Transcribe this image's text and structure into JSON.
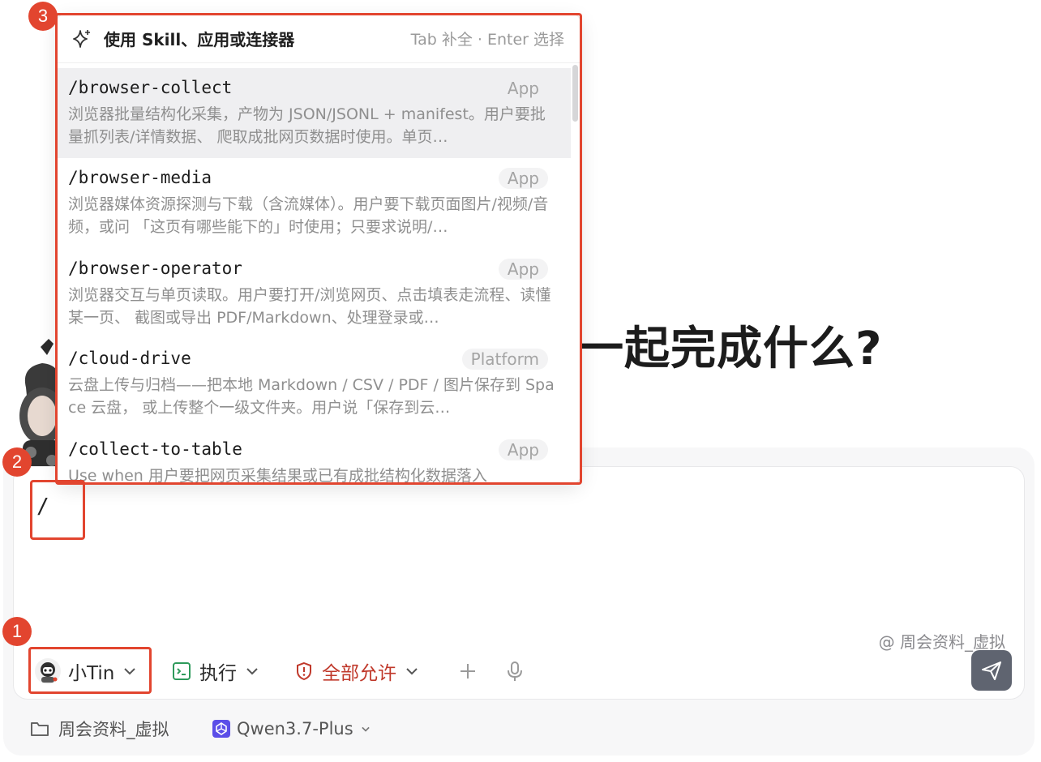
{
  "heading": "一起完成什么?",
  "composer": {
    "input_value": "/",
    "mention": "@ 周会资料_虚拟"
  },
  "toolbar": {
    "agent_name": "小Tin",
    "exec_label": "执行",
    "permission_label": "全部允许",
    "plus_icon": "plus-icon",
    "mic_icon": "microphone-icon",
    "send_icon": "send-icon"
  },
  "footer": {
    "folder_label": "周会资料_虚拟",
    "model_label": "Qwen3.7-Plus"
  },
  "popup": {
    "title": "使用 Skill、应用或连接器",
    "hint": "Tab 补全 · Enter 选择",
    "items": [
      {
        "command": "/browser-collect",
        "badge": "App",
        "description": "浏览器批量结构化采集，产物为 JSON/JSONL + manifest。用户要批量抓列表/详情数据、 爬取成批网页数据时使用。单页…"
      },
      {
        "command": "/browser-media",
        "badge": "App",
        "description": "浏览器媒体资源探测与下载（含流媒体）。用户要下载页面图片/视频/音频，或问 「这页有哪些能下的」时使用；只要求说明/…"
      },
      {
        "command": "/browser-operator",
        "badge": "App",
        "description": "浏览器交互与单页读取。用户要打开/浏览网页、点击填表走流程、读懂某一页、 截图或导出 PDF/Markdown、处理登录或…"
      },
      {
        "command": "/cloud-drive",
        "badge": "Platform",
        "description": "云盘上传与归档——把本地 Markdown / CSV / PDF / 图片保存到 Space 云盘， 或上传整个一级文件夹。用户说「保存到云…"
      },
      {
        "command": "/collect-to-table",
        "badge": "App",
        "description": "Use when 用户要把网页采集结果或已有成批结构化数据落入"
      }
    ]
  },
  "annotations": {
    "one": "1",
    "two": "2",
    "three": "3"
  },
  "colors": {
    "annotation_red": "#e2452f",
    "permission_red": "#c0392b",
    "send_button": "#5f6470"
  }
}
